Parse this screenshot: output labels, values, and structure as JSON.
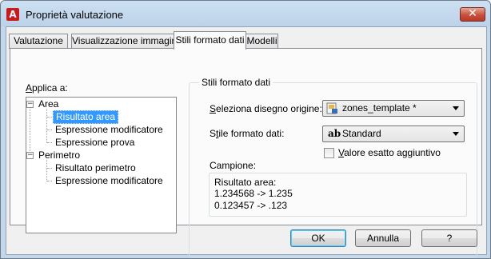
{
  "window": {
    "title": "Proprietà valutazione",
    "app_icon_letter": "A",
    "close_symbol": "✕"
  },
  "tabs": [
    {
      "label": "Valutazione",
      "active": false
    },
    {
      "label": "Visualizzazione immagine",
      "active": false
    },
    {
      "label": "Stili formato dati",
      "active": true
    },
    {
      "label": "Modelli",
      "active": false
    }
  ],
  "apply_to": {
    "label": "Applica a:",
    "tree": [
      {
        "label": "Area",
        "expander": "−"
      },
      {
        "label": "Risultato area",
        "selected": true
      },
      {
        "label": "Espressione modificatore"
      },
      {
        "label": "Espressione prova"
      },
      {
        "label": "Perimetro",
        "expander": "−"
      },
      {
        "label": "Risultato perimetro"
      },
      {
        "label": "Espressione modificatore"
      }
    ]
  },
  "data_format_styles": {
    "group_title": "Stili formato dati",
    "source_drawing_label": "Seleziona disegno origine:",
    "source_drawing_value": "zones_template *",
    "format_style_label": "Stile formato dati:",
    "format_style_value": "Standard",
    "format_style_icon_text": "ab",
    "extra_exact_value_label": "Valore esatto aggiuntivo",
    "extra_exact_value_checked": false,
    "sample_label": "Campione:",
    "sample_lines": [
      "Risultato area:",
      "1.234568 -> 1.235",
      "0.123457 -> .123"
    ]
  },
  "buttons": {
    "ok": "OK",
    "cancel": "Annulla",
    "help": "?"
  }
}
